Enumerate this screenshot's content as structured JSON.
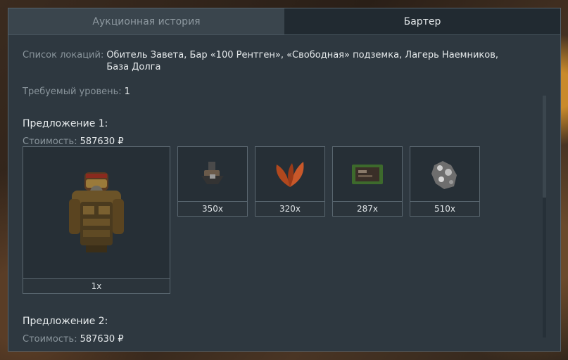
{
  "tabs": [
    {
      "label": "Аукционная история",
      "active": false
    },
    {
      "label": "Бартер",
      "active": true
    }
  ],
  "locations": {
    "label": "Список локаций:",
    "line1": "Обитель Завета, Бар «100 Рентген», «Свободная» подземка, Лагерь Наемников,",
    "line2": "База Долга"
  },
  "required_level": {
    "label": "Требуемый уровень:",
    "value": "1"
  },
  "offers": [
    {
      "title": "Предложение 1:",
      "cost_label": "Стоимость:",
      "cost_value": "587630 ₽",
      "items": [
        {
          "icon": "armor-suit-icon",
          "qty": "1x"
        },
        {
          "icon": "electronic-device-icon",
          "qty": "350x"
        },
        {
          "icon": "red-leaf-icon",
          "qty": "320x"
        },
        {
          "icon": "circuit-board-icon",
          "qty": "287x"
        },
        {
          "icon": "ore-chunk-icon",
          "qty": "510x"
        }
      ]
    },
    {
      "title": "Предложение 2:",
      "cost_label": "Стоимость:",
      "cost_value": "587630 ₽"
    }
  ]
}
